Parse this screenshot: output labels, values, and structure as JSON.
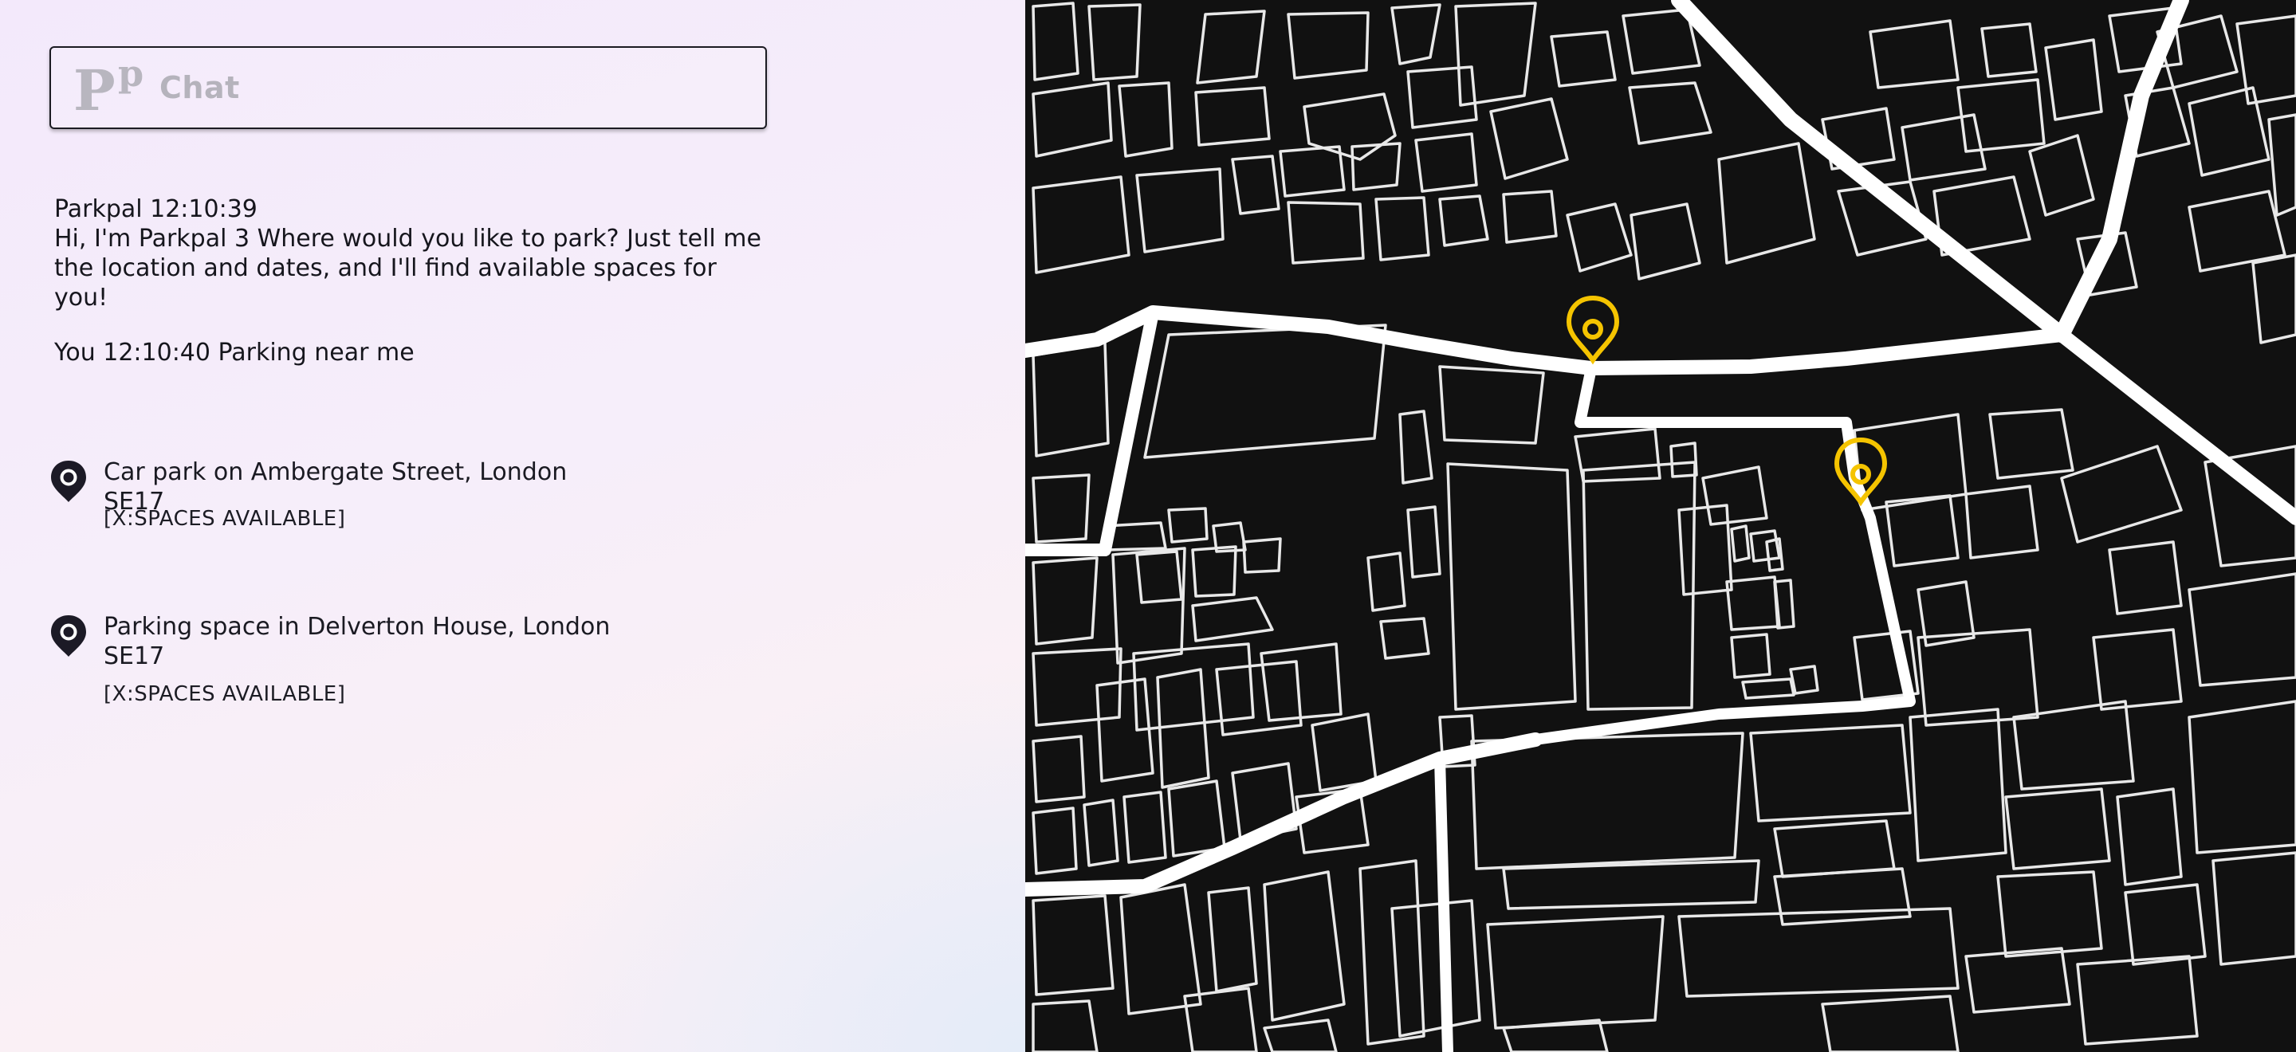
{
  "chat": {
    "logo_text": "P",
    "logo_superscript": "p",
    "label": "Chat"
  },
  "messages": [
    {
      "sender": "Parkpal",
      "time": "12:10:39",
      "header": "Parkpal 12:10:39",
      "text": "Hi, I'm Parkpal 3 Where would you like to park? Just tell me the location and dates, and I'll find available spaces for you!"
    },
    {
      "sender": "You",
      "time": "12:10:40",
      "text": "You 12:10:40 Parking near me"
    }
  ],
  "results": [
    {
      "title": "Car park on Ambergate Street, London SE17",
      "availability": "[X:SPACES AVAILABLE]",
      "icon": "location-pin-icon"
    },
    {
      "title": "Parking space in Delverton House, London SE17",
      "availability": "[X:SPACES AVAILABLE]",
      "icon": "location-pin-icon"
    }
  ],
  "map": {
    "background_color": "#111111",
    "road_color": "#ffffff",
    "marker_color": "#f5c400",
    "markers": [
      "location-pin-icon",
      "location-pin-icon"
    ]
  }
}
